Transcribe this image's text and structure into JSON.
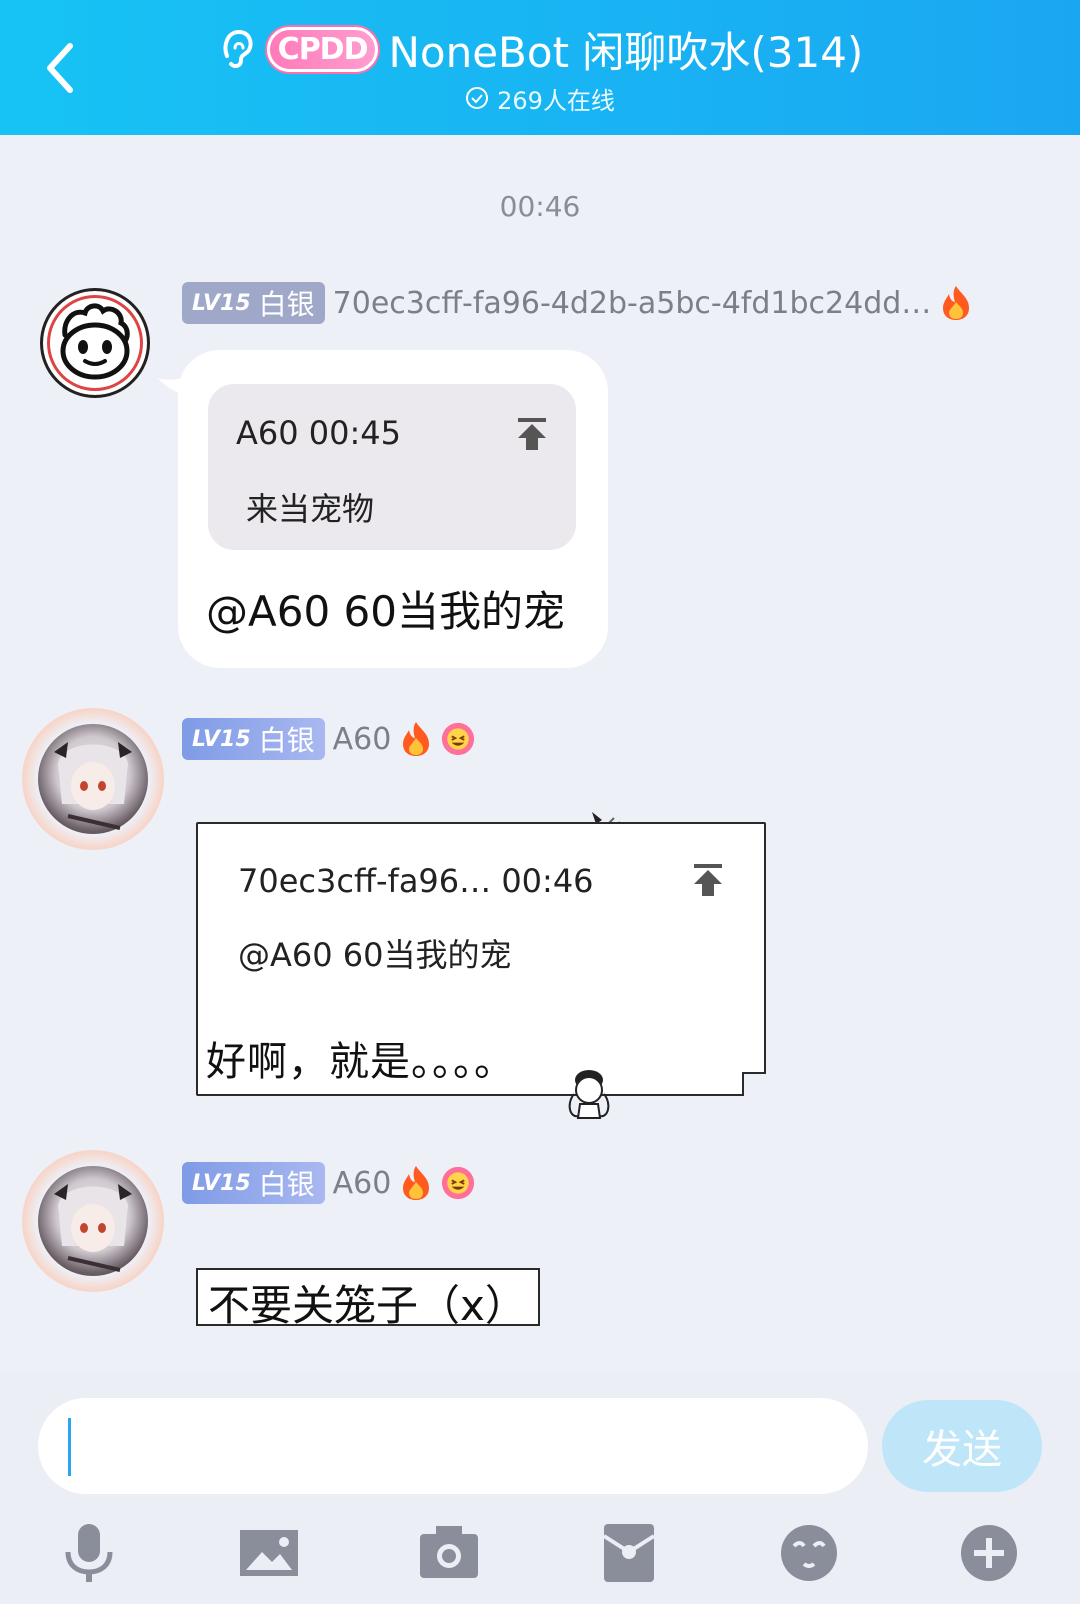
{
  "header": {
    "badge": "CPDD",
    "title": "NoneBot 闲聊吹水(314)",
    "online": "269人在线"
  },
  "time_separator": "00:46",
  "messages": [
    {
      "level_tag": "LV15",
      "level_name": "白银",
      "sender": "70ec3cff-fa96-4d2b-a5bc-4fd1bc24dd…",
      "quote_head": "A60 00:45",
      "quote_body": "来当宠物",
      "text": "@A60 60当我的宠"
    },
    {
      "level_tag": "LV15",
      "level_name": "白银",
      "sender": "A60",
      "quote_head": "70ec3cff-fa96… 00:46",
      "quote_body": "@A60 60当我的宠",
      "text": "好啊，就是。。。。"
    },
    {
      "level_tag": "LV15",
      "level_name": "白银",
      "sender": "A60",
      "text": "不要关笼子（x）"
    }
  ],
  "composer": {
    "input_value": "",
    "send_label": "发送"
  },
  "toolbar_icons": [
    "microphone-icon",
    "image-icon",
    "camera-icon",
    "red-packet-icon",
    "emoji-icon",
    "plus-icon"
  ],
  "colors": {
    "header_start": "#17c3f4",
    "header_end": "#1aa7f2",
    "send_button": "#bfe6f8",
    "level_badge": "#9fa8c9"
  }
}
